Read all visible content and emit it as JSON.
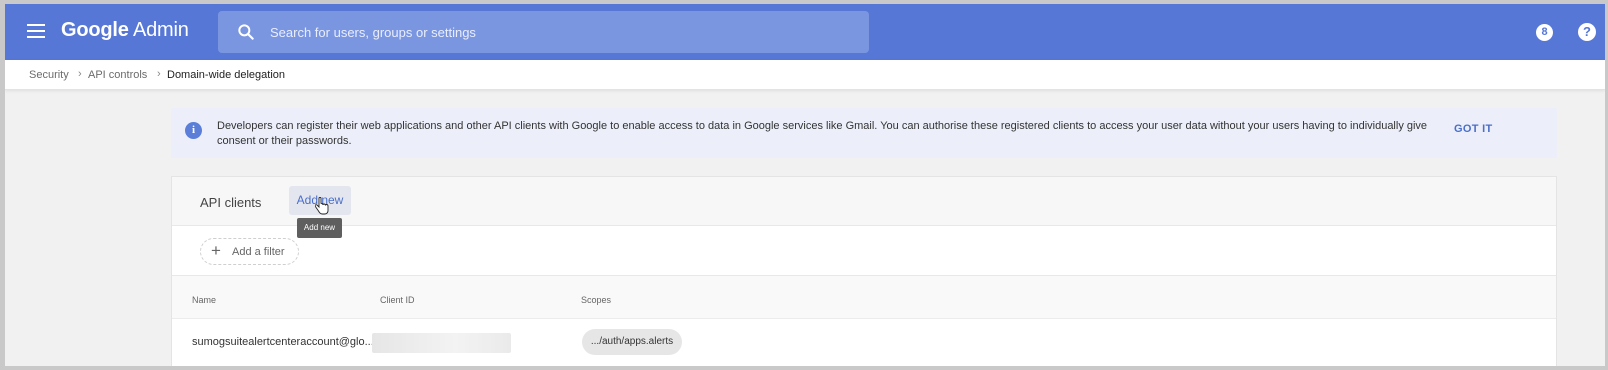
{
  "header": {
    "logo_google": "Google",
    "logo_product": "Admin",
    "search_placeholder": "Search for users, groups or settings",
    "account_initial": "8",
    "help_glyph": "?"
  },
  "breadcrumb": {
    "items": [
      "Security",
      "API controls",
      "Domain-wide delegation"
    ],
    "separator": "›"
  },
  "banner": {
    "text": "Developers can register their web applications and other API clients with Google to enable access to data in Google services like Gmail. You can authorise these registered clients to access your user data without your users having to individually give consent or their passwords.",
    "action": "GOT IT",
    "info_glyph": "i"
  },
  "card": {
    "title": "API clients",
    "add_new_label": "Add new",
    "tooltip": "Add new",
    "filter_label": "Add a filter",
    "columns": [
      "Name",
      "Client ID",
      "Scopes"
    ],
    "rows": [
      {
        "name": "sumogsuitealertcenteraccount@glo...",
        "client_id": "",
        "scopes": ".../auth/apps.alerts"
      }
    ]
  },
  "colors": {
    "topbar": "#5677d6",
    "accent": "#4a6ec9"
  }
}
